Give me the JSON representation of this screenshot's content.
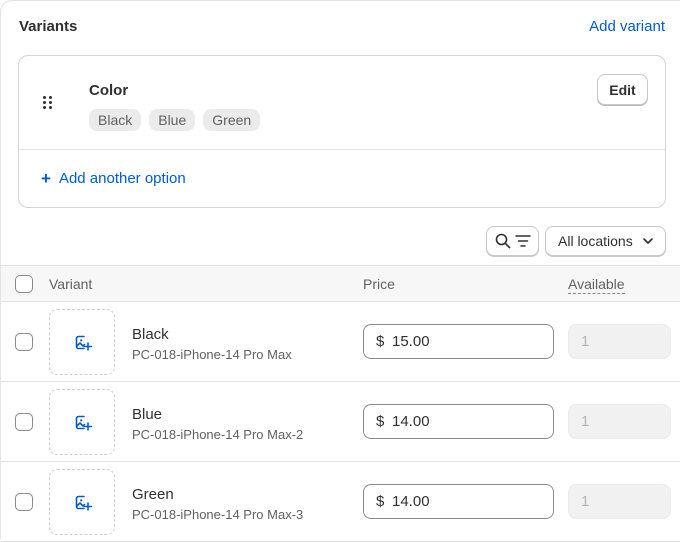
{
  "section": {
    "title": "Variants",
    "add_variant_label": "Add variant"
  },
  "option": {
    "name": "Color",
    "values": [
      "Black",
      "Blue",
      "Green"
    ],
    "edit_label": "Edit",
    "add_another_label": "Add another option"
  },
  "toolbar": {
    "location_label": "All locations"
  },
  "table": {
    "headers": {
      "variant": "Variant",
      "price": "Price",
      "available": "Available"
    },
    "rows": [
      {
        "name": "Black",
        "sku": "PC-018-iPhone-14 Pro Max",
        "currency": "$",
        "price": "15.00",
        "available": "1"
      },
      {
        "name": "Blue",
        "sku": "PC-018-iPhone-14 Pro Max-2",
        "currency": "$",
        "price": "14.00",
        "available": "1"
      },
      {
        "name": "Green",
        "sku": "PC-018-iPhone-14 Pro Max-3",
        "currency": "$",
        "price": "14.00",
        "available": "1"
      }
    ]
  },
  "icons": {
    "drag": "drag-handle-icon",
    "plus": "plus-icon",
    "search": "search-icon",
    "filter": "filter-icon",
    "chevron": "chevron-down-icon",
    "add_image": "add-image-icon"
  },
  "colors": {
    "link": "#005bd3",
    "text": "#303030",
    "muted": "#616161"
  }
}
